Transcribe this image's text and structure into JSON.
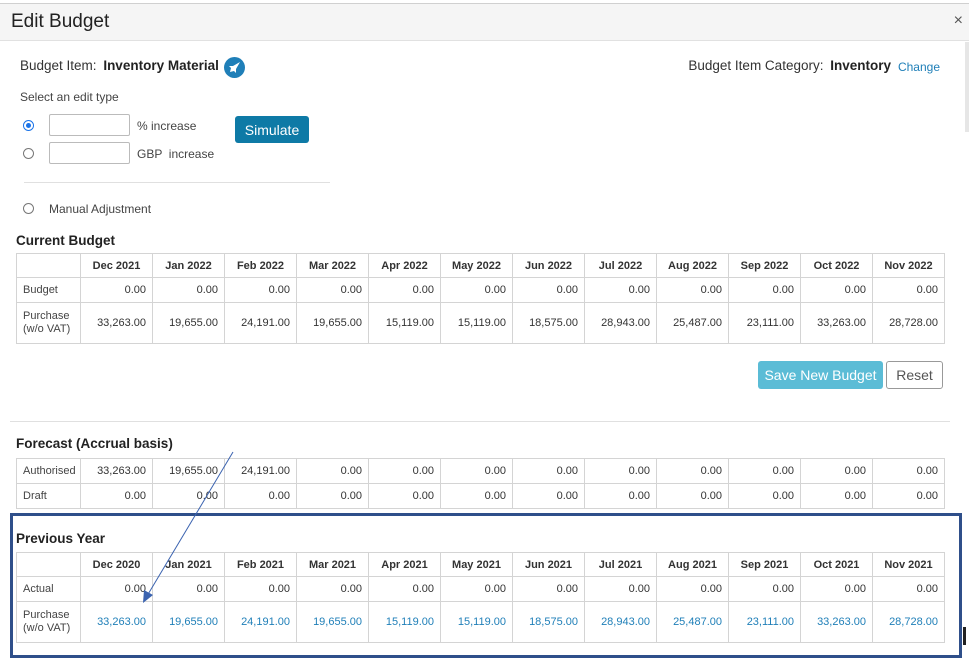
{
  "dialog": {
    "title": "Edit Budget",
    "close": "×"
  },
  "budget_item": {
    "label": "Budget Item:",
    "value": "Inventory Material"
  },
  "category": {
    "label": "Budget Item Category:",
    "value": "Inventory",
    "change": "Change"
  },
  "edit_type": {
    "label": "Select an edit type",
    "percent_label": "% increase",
    "gbp_label": "GBP  increase",
    "percent_value": "",
    "gbp_value": "",
    "simulate": "Simulate",
    "manual": "Manual Adjustment"
  },
  "current_budget": {
    "title": "Current Budget",
    "months": [
      "Dec 2021",
      "Jan 2022",
      "Feb 2022",
      "Mar 2022",
      "Apr 2022",
      "May 2022",
      "Jun 2022",
      "Jul 2022",
      "Aug 2022",
      "Sep 2022",
      "Oct 2022",
      "Nov 2022"
    ],
    "rows": [
      {
        "label": "Budget",
        "values": [
          "0.00",
          "0.00",
          "0.00",
          "0.00",
          "0.00",
          "0.00",
          "0.00",
          "0.00",
          "0.00",
          "0.00",
          "0.00",
          "0.00"
        ]
      },
      {
        "label": "Purchase (w/o VAT)",
        "values": [
          "33,263.00",
          "19,655.00",
          "24,191.00",
          "19,655.00",
          "15,119.00",
          "15,119.00",
          "18,575.00",
          "28,943.00",
          "25,487.00",
          "23,111.00",
          "33,263.00",
          "28,728.00"
        ]
      }
    ]
  },
  "actions": {
    "save": "Save New Budget",
    "reset": "Reset"
  },
  "forecast": {
    "title": "Forecast (Accrual basis)",
    "rows": [
      {
        "label": "Authorised",
        "values": [
          "33,263.00",
          "19,655.00",
          "24,191.00",
          "0.00",
          "0.00",
          "0.00",
          "0.00",
          "0.00",
          "0.00",
          "0.00",
          "0.00",
          "0.00"
        ]
      },
      {
        "label": "Draft",
        "values": [
          "0.00",
          "0.00",
          "0.00",
          "0.00",
          "0.00",
          "0.00",
          "0.00",
          "0.00",
          "0.00",
          "0.00",
          "0.00",
          "0.00"
        ]
      }
    ]
  },
  "previous_year": {
    "title": "Previous Year",
    "months": [
      "Dec 2020",
      "Jan 2021",
      "Feb 2021",
      "Mar 2021",
      "Apr 2021",
      "May 2021",
      "Jun 2021",
      "Jul 2021",
      "Aug 2021",
      "Sep 2021",
      "Oct 2021",
      "Nov 2021"
    ],
    "rows": [
      {
        "label": "Actual",
        "values": [
          "0.00",
          "0.00",
          "0.00",
          "0.00",
          "0.00",
          "0.00",
          "0.00",
          "0.00",
          "0.00",
          "0.00",
          "0.00",
          "0.00"
        ]
      },
      {
        "label": "Purchase (w/o VAT)",
        "values": [
          "33,263.00",
          "19,655.00",
          "24,191.00",
          "19,655.00",
          "15,119.00",
          "15,119.00",
          "18,575.00",
          "28,943.00",
          "25,487.00",
          "23,111.00",
          "33,263.00",
          "28,728.00"
        ]
      }
    ]
  },
  "colors": {
    "primary": "#0e7aa6",
    "link": "#1f7fb8",
    "save_disabled": "#5bbcd6",
    "highlight": "#2f4f8a"
  }
}
